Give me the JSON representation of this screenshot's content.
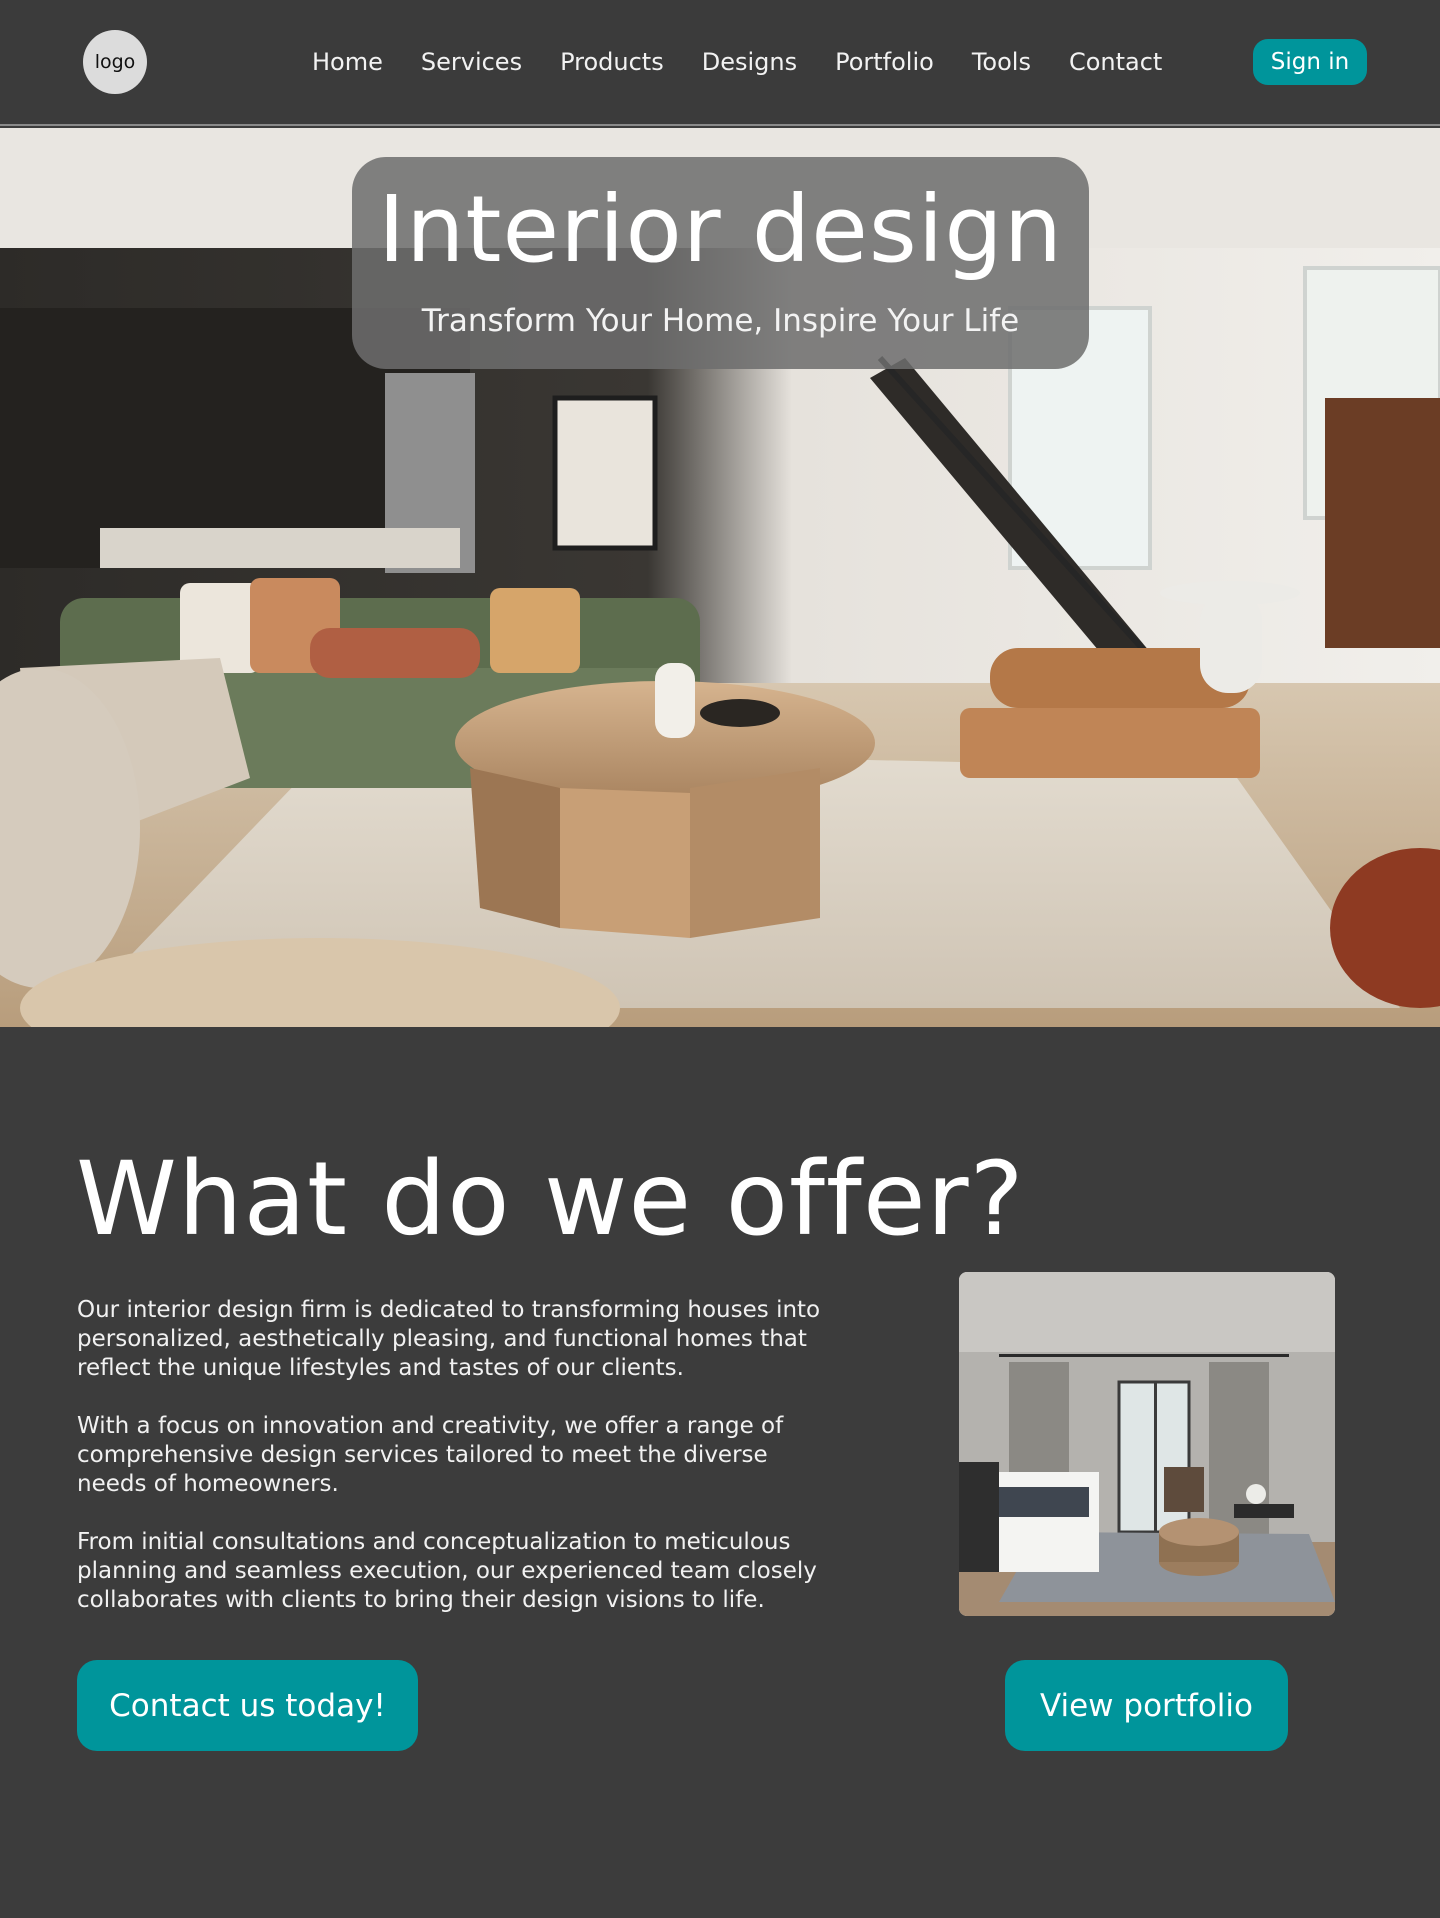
{
  "header": {
    "logo_text": "logo",
    "nav": [
      "Home",
      "Services",
      "Products",
      "Designs",
      "Portfolio",
      "Tools",
      "Contact"
    ],
    "signin_label": "Sign in"
  },
  "hero": {
    "title": "Interior design",
    "subtitle": "Transform Your Home, Inspire Your Life"
  },
  "offer": {
    "heading": "What do we offer?",
    "paragraphs": [
      "Our interior design firm is dedicated to transforming houses into personalized, aesthetically pleasing, and functional homes that reflect the unique lifestyles and tastes of our clients.",
      "With a focus on innovation and creativity, we offer a range of comprehensive design services tailored to meet the diverse needs of homeowners.",
      "From initial consultations and conceptualization to meticulous planning and seamless execution, our experienced team closely collaborates  with clients to bring their design visions to life."
    ],
    "contact_button": "Contact us today!",
    "portfolio_button": "View portfolio"
  },
  "colors": {
    "background": "#3c3c3c",
    "accent": "#00959b",
    "text": "#ffffff"
  }
}
